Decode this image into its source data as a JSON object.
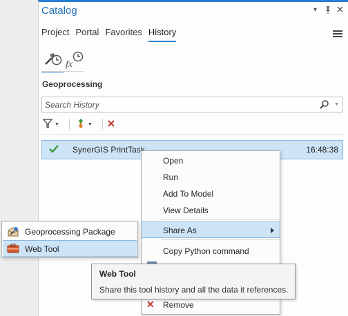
{
  "pane": {
    "title": "Catalog",
    "controls": [
      "▾",
      "📌",
      "✕"
    ],
    "tabs": [
      {
        "label": "Project",
        "active": false
      },
      {
        "label": "Portal",
        "active": false
      },
      {
        "label": "Favorites",
        "active": false
      },
      {
        "label": "History",
        "active": true
      }
    ],
    "subtabs": [
      {
        "icon": "geoprocessing-history-icon",
        "active": true
      },
      {
        "icon": "function-history-icon",
        "active": false
      }
    ],
    "section_title": "Geoprocessing",
    "search": {
      "placeholder": "Search History",
      "value": ""
    },
    "toolbar": [
      {
        "icon": "filter-icon",
        "has_dropdown": true
      },
      {
        "icon": "sort-icon",
        "has_dropdown": true
      },
      {
        "icon": "clear-icon",
        "has_dropdown": false
      }
    ],
    "history_items": [
      {
        "name": "SynerGIS PrintTask",
        "time": "16:48:38",
        "status": "success",
        "selected": true
      }
    ]
  },
  "context_menu": {
    "items": [
      {
        "label": "Open"
      },
      {
        "label": "Run"
      },
      {
        "label": "Add To Model"
      },
      {
        "label": "View Details"
      },
      {
        "label": "Share As",
        "has_submenu": true,
        "highlighted": true
      },
      {
        "label": "Copy Python command"
      },
      {
        "label": "Remove",
        "icon": "remove-icon"
      }
    ]
  },
  "submenu": {
    "items": [
      {
        "label": "Geoprocessing Package",
        "icon": "geoprocessing-package-icon"
      },
      {
        "label": "Web Tool",
        "icon": "web-tool-icon",
        "highlighted": true
      }
    ]
  },
  "tooltip": {
    "title": "Web Tool",
    "description": "Share this tool history and all the data it references."
  },
  "colors": {
    "accent": "#2a7fd0",
    "selection": "#cde4f7",
    "selection_border": "#8ab8e0",
    "success": "#3a9a3a",
    "remove": "#c1392b"
  }
}
